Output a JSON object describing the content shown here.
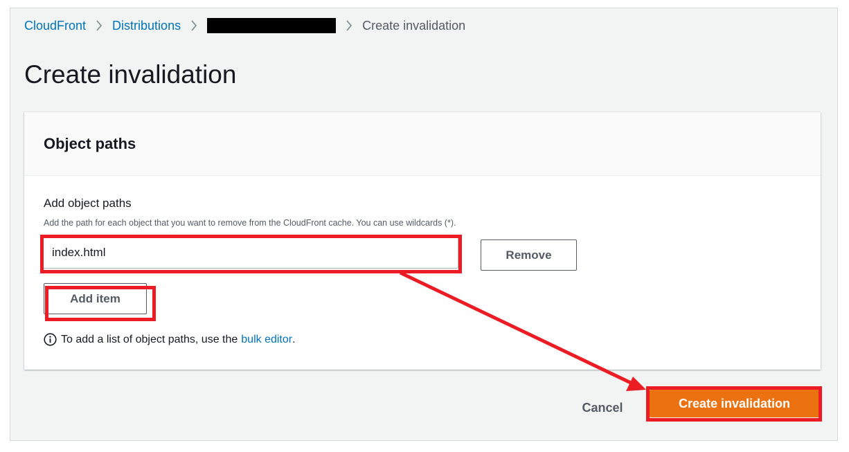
{
  "breadcrumb": {
    "items": [
      "CloudFront",
      "Distributions"
    ],
    "current": "Create invalidation"
  },
  "page": {
    "title": "Create invalidation"
  },
  "panel": {
    "title": "Object paths",
    "field_label": "Add object paths",
    "field_description": "Add the path for each object that you want to remove from the CloudFront cache. You can use wildcards (*).",
    "path_value": "index.html",
    "remove_label": "Remove",
    "add_item_label": "Add item",
    "info_text": "To add a list of object paths, use the",
    "bulk_editor_link": "bulk editor",
    "info_suffix": "."
  },
  "footer": {
    "cancel_label": "Cancel",
    "submit_label": "Create invalidation"
  },
  "colors": {
    "link": "#0073bb",
    "primary": "#ec7211",
    "annotation": "#ec1c24"
  }
}
